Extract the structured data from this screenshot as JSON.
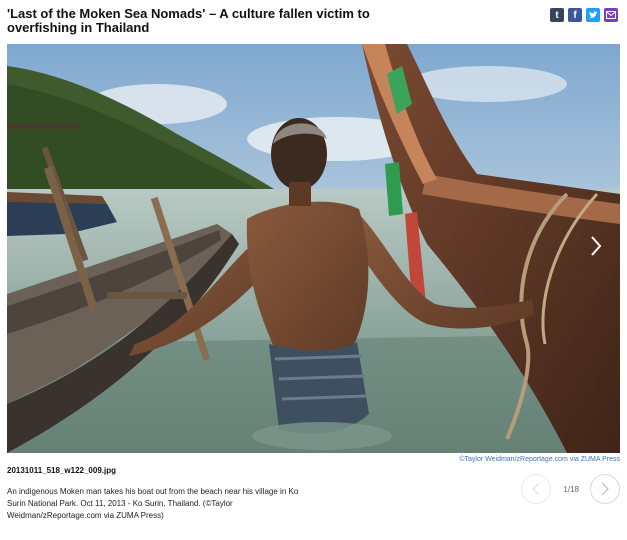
{
  "article": {
    "title": "'Last of the Moken Sea Nomads' – A culture fallen victim to overfishing in Thailand"
  },
  "share": [
    {
      "name": "tumblr-icon",
      "glyph": "t",
      "color": "#35465c"
    },
    {
      "name": "facebook-icon",
      "glyph": "f",
      "color": "#3b5998"
    },
    {
      "name": "twitter-icon",
      "glyph": "❧",
      "color": "#1da1f2"
    },
    {
      "name": "email-icon",
      "glyph": "✉",
      "color": "#7b3fb5"
    }
  ],
  "photo": {
    "credit": "©Taylor Weidman/zReportage.com via ZUMA Press",
    "filename": "20131011_518_w122_009.jpg",
    "caption": "An indigenous Moken man takes his boat out from the beach near his village in Ko Surin National Park. Oct 11, 2013 - Ko Surin, Thailand. (©Taylor Weidman/zReportage.com via ZUMA Press)"
  },
  "pager": {
    "counter": "1/18",
    "prev_icon": "chevron-left-icon",
    "next_icon": "chevron-right-icon"
  }
}
